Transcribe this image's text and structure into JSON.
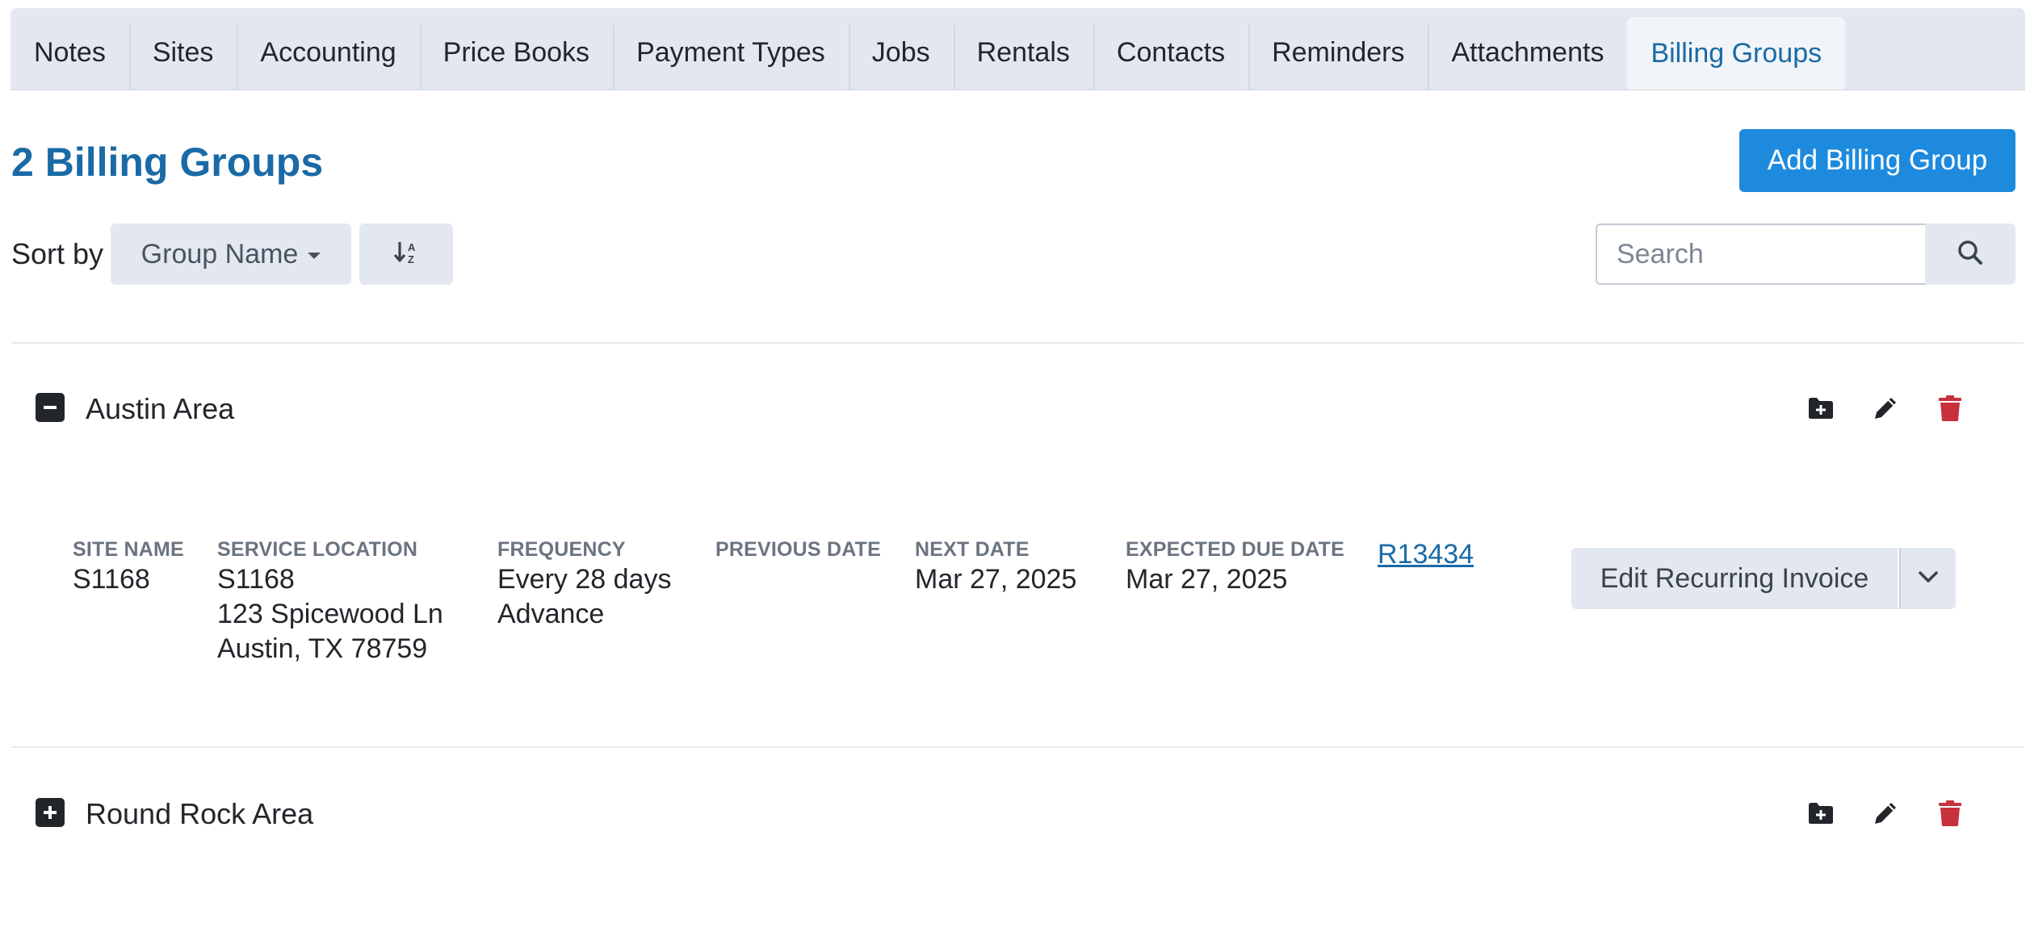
{
  "tabs": [
    {
      "label": "Notes",
      "active": false
    },
    {
      "label": "Sites",
      "active": false
    },
    {
      "label": "Accounting",
      "active": false
    },
    {
      "label": "Price Books",
      "active": false
    },
    {
      "label": "Payment Types",
      "active": false
    },
    {
      "label": "Jobs",
      "active": false
    },
    {
      "label": "Rentals",
      "active": false
    },
    {
      "label": "Contacts",
      "active": false
    },
    {
      "label": "Reminders",
      "active": false
    },
    {
      "label": "Attachments",
      "active": false
    },
    {
      "label": "Billing Groups",
      "active": true
    }
  ],
  "header": {
    "title": "2 Billing Groups",
    "add_button": "Add Billing Group"
  },
  "sort": {
    "label": "Sort by",
    "selected": "Group Name",
    "direction_icon": "sort-alpha-down-icon"
  },
  "search": {
    "placeholder": "Search",
    "value": ""
  },
  "groups": [
    {
      "name": "Austin Area",
      "expanded": true,
      "detail": {
        "site_name_label": "SITE NAME",
        "site_name": "S1168",
        "service_location_label": "SERVICE LOCATION",
        "service_location": [
          "S1168",
          "123 Spicewood Ln",
          "Austin, TX 78759"
        ],
        "frequency_label": "FREQUENCY",
        "frequency": [
          "Every 28 days",
          "Advance"
        ],
        "previous_date_label": "PREVIOUS DATE",
        "previous_date": "",
        "next_date_label": "NEXT DATE",
        "next_date": "Mar 27, 2025",
        "expected_due_date_label": "EXPECTED DUE DATE",
        "expected_due_date": "Mar 27, 2025",
        "invoice_link": "R13434",
        "edit_button": "Edit Recurring Invoice"
      }
    },
    {
      "name": "Round Rock Area",
      "expanded": false
    }
  ],
  "colors": {
    "accent": "#1a6aa6",
    "primary_button": "#1d8ade",
    "delete": "#c8313c",
    "tab_bg": "#e3e8f0"
  }
}
